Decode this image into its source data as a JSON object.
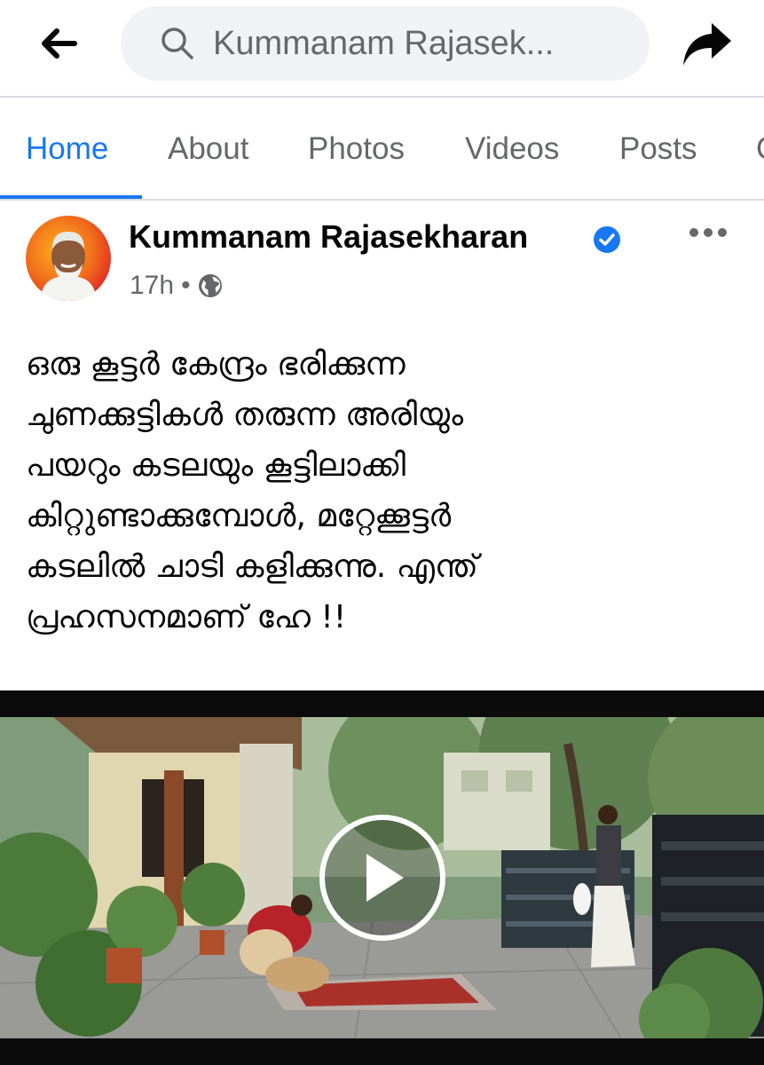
{
  "topbar": {
    "search_text": "Kummanam Rajasek...",
    "back_icon": "arrow-left-icon",
    "share_icon": "share-arrow-icon"
  },
  "tabs": [
    {
      "label": "Home",
      "active": true
    },
    {
      "label": "About"
    },
    {
      "label": "Photos"
    },
    {
      "label": "Videos"
    },
    {
      "label": "Posts"
    },
    {
      "label": "C"
    }
  ],
  "post": {
    "author": "Kummanam Rajasekharan",
    "time": "17h",
    "separator": "•",
    "audience_icon": "globe-icon",
    "lines": [
      "ഒരു കൂട്ടർ കേന്ദ്രം ഭരിക്കുന്ന",
      "ചുണക്കുട്ടികൾ തരുന്ന അരിയും",
      "പയറും കടലയും കൂട്ടിലാക്കി",
      "കിറ്റുണ്ടാക്കുമ്പോൾ, മറ്റേക്കൂട്ടർ",
      "കടലിൽ ചാടി കളിക്കുന്നു. എന്ത്",
      "പ്രഹസനമാണ് ഹേ !!"
    ]
  },
  "colors": {
    "accent": "#1877f2",
    "muted": "#65676b",
    "text": "#050505"
  }
}
